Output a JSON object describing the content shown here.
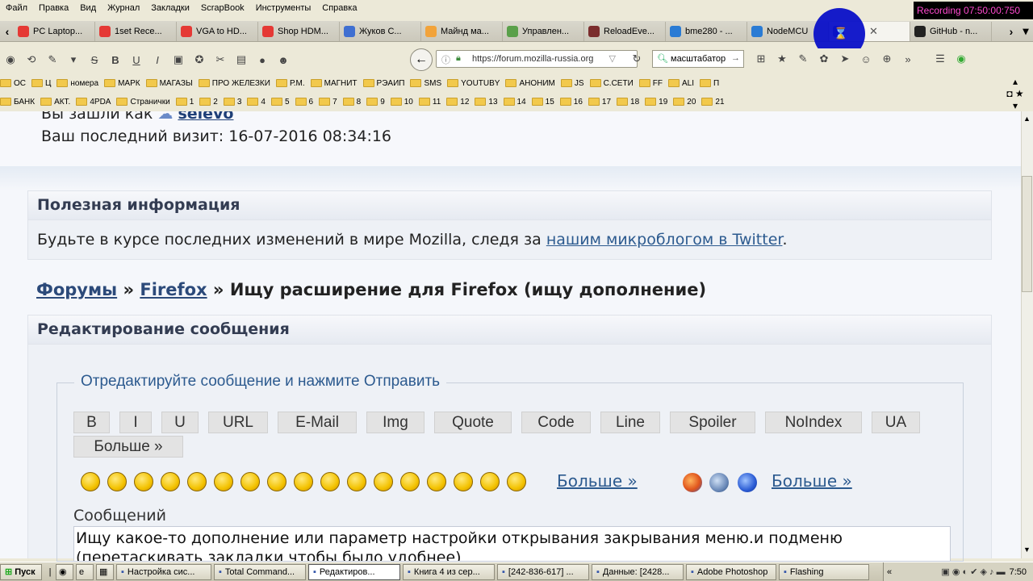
{
  "menu": [
    "Файл",
    "Правка",
    "Вид",
    "Журнал",
    "Закладки",
    "ScrapBook",
    "Инструменты",
    "Справка"
  ],
  "recording": "Recording 07:50:00:750",
  "tabs": [
    {
      "label": "PC Laptop...",
      "color": "#e53935"
    },
    {
      "label": "1set Rece...",
      "color": "#e53935"
    },
    {
      "label": "VGA to HD...",
      "color": "#e53935"
    },
    {
      "label": "Shop HDM...",
      "color": "#e53935"
    },
    {
      "label": "Жуков С...",
      "color": "#3f6fd1"
    },
    {
      "label": "Майнд ма...",
      "color": "#f2a33a"
    },
    {
      "label": "Управлен...",
      "color": "#5aa04a"
    },
    {
      "label": "ReloadEve...",
      "color": "#7b2d2d"
    },
    {
      "label": "bme280 - ...",
      "color": "#2a7bd4"
    },
    {
      "label": "NodeMCU",
      "color": "#2a7bd4"
    },
    {
      "label": "",
      "color": "#1e3aa0"
    },
    {
      "label": "GitHub - n...",
      "color": "#222222"
    }
  ],
  "url": "https://forum.mozilla-russia.org",
  "search_value": "масштабатор",
  "bookmarks_row1": [
    "ОС",
    "Ц",
    "номера",
    "МАРК",
    "МАГАЗЫ",
    "ПРО ЖЕЛЕЗКИ",
    "Р.М.",
    "МАГНИТ",
    "РЭАИП",
    "SMS",
    "YOUTUBY",
    "АНОНИМ",
    "JS",
    "С.СЕТИ",
    "FF",
    "ALI",
    "П"
  ],
  "bookmarks_row2": [
    "БАНК",
    "АКТ.",
    "4PDA",
    "Странички",
    "1",
    "2",
    "3",
    "4",
    "5",
    "6",
    "7",
    "8",
    "9",
    "10",
    "11",
    "12",
    "13",
    "14",
    "15",
    "16",
    "17",
    "18",
    "19",
    "20",
    "21"
  ],
  "page": {
    "login_text": "Вы зашли как",
    "username": "selevo",
    "last_visit": "Ваш последний визит: 16-07-2016 08:34:16",
    "info_title": "Полезная информация",
    "info_text": "Будьте в курсе последних изменений в мире Mozilla, следя за",
    "info_link": "нашим микроблогом в Twitter",
    "info_dot": ".",
    "crumb_forums": "Форумы",
    "crumb_sep": "»",
    "crumb_firefox": "Firefox",
    "crumb_topic": "Ищу расширение для Firefox (ищу дополнение)",
    "edit_title": "Редактирование сообщения",
    "legend": "Отредактируйте сообщение и нажмите Отправить",
    "buttons": [
      "B",
      "I",
      "U",
      "URL",
      "E-Mail",
      "Img",
      "Quote",
      "Code",
      "Line",
      "Spoiler",
      "NoIndex",
      "UA",
      "Больше »"
    ],
    "more1": "Больше »",
    "more2": "Больше »",
    "msg_label": "Сообщений",
    "msg_line1": "Ищу какое-то дополнение или параметр настройки открывания закрывания меню.и подменю",
    "msg_line2": "(перетаскивать закладки чтобы было удобнее)"
  },
  "taskbar": {
    "start": "Пуск",
    "items": [
      "Настройка сис...",
      "Total Command...",
      "Редактиров...",
      "Книга 4 из сер...",
      "[242-836-617] ...",
      "Данные: [2428...",
      "Adobe Photoshop",
      "Flashing"
    ],
    "clock": "7:50"
  }
}
